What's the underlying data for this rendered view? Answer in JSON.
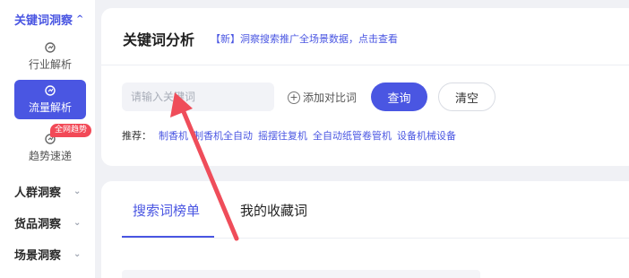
{
  "sidebar": {
    "sections": [
      {
        "label": "关键词洞察",
        "chevron": "^"
      },
      {
        "label": "人群洞察",
        "chevron": "⌄"
      },
      {
        "label": "货品洞察",
        "chevron": "⌄"
      },
      {
        "label": "场景洞察",
        "chevron": "⌄"
      }
    ],
    "items": [
      {
        "label": "行业解析",
        "icon": "analytics-icon"
      },
      {
        "label": "流量解析",
        "icon": "analytics-icon"
      },
      {
        "label": "趋势速递",
        "icon": "analytics-icon",
        "badge": "全网趋势"
      }
    ]
  },
  "header": {
    "title": "关键词分析",
    "notice": "【新】洞察搜索推广全场景数据，点击查看"
  },
  "search": {
    "placeholder": "请输入关键词",
    "add_compare_label": "添加对比词",
    "query_label": "查询",
    "clear_label": "清空"
  },
  "recommend": {
    "label": "推荐：",
    "items": [
      "制香机",
      "制香机全自动",
      "摇摆往复机",
      "全自动纸管卷管机",
      "设备机械设备"
    ]
  },
  "tabs": [
    {
      "label": "搜索词榜单"
    },
    {
      "label": "我的收藏词"
    }
  ],
  "colors": {
    "accent": "#4a56e2",
    "badge": "#f24957",
    "arrow": "#ef4d5a"
  }
}
